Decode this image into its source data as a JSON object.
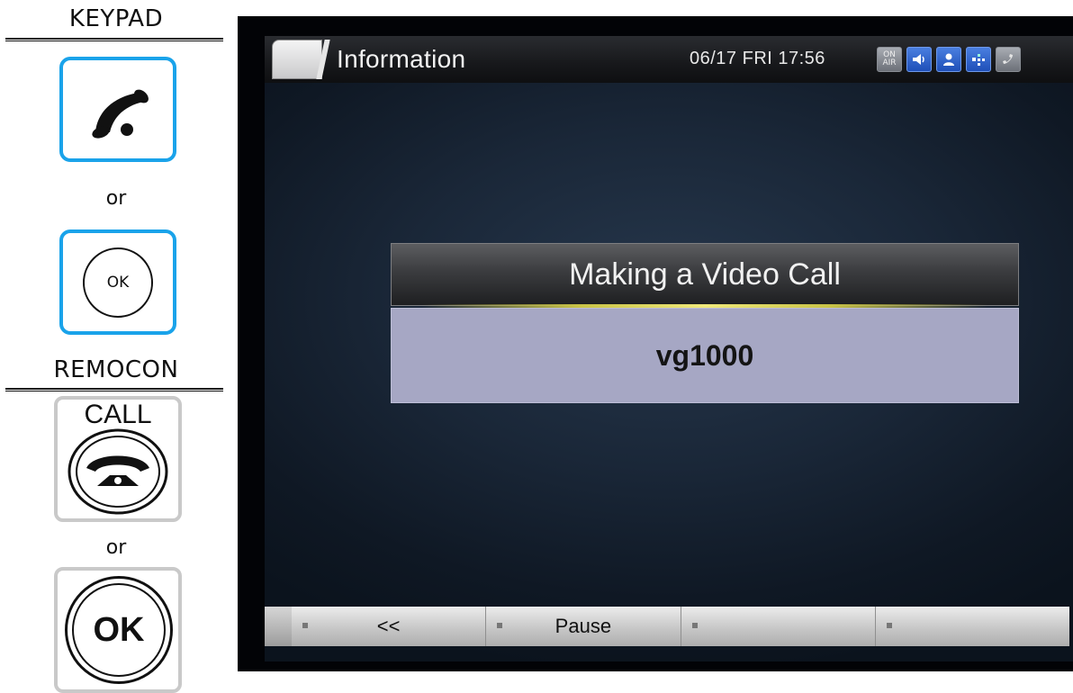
{
  "instructions": {
    "keypad_heading": "KEYPAD",
    "remocon_heading": "REMOCON",
    "or_1": "or",
    "or_2": "or",
    "ok_key_label": "OK",
    "call_key_label": "CALL",
    "remocon_ok_label": "OK"
  },
  "screen": {
    "title": "Information",
    "datetime": "06/17 FRI 17:56",
    "status_icons": [
      {
        "name": "on-air-icon",
        "text": "ON AIR"
      },
      {
        "name": "speaker-icon"
      },
      {
        "name": "contact-icon"
      },
      {
        "name": "network-icon"
      },
      {
        "name": "handset-icon"
      }
    ],
    "dialog": {
      "title": "Making a Video Call",
      "callee": "vg1000"
    },
    "soft_keys": [
      "<<",
      "Pause",
      "",
      ""
    ]
  },
  "colors": {
    "keypad_border": "#1aa3ea",
    "remocon_border": "#c9c9c9",
    "dialog_body": "#a6a7c4",
    "status_blue": "#2f62d0"
  }
}
